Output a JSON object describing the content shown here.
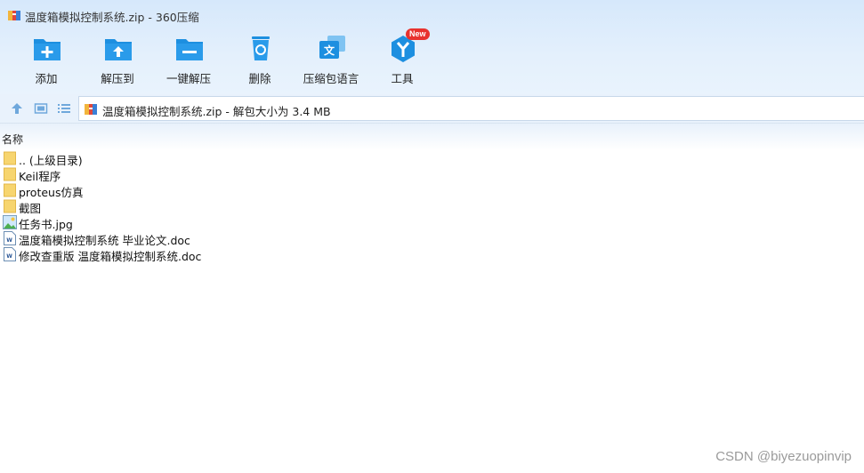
{
  "window": {
    "title": "温度箱模拟控制系统.zip - 360压缩"
  },
  "toolbar": {
    "items": [
      {
        "label": "添加",
        "icon": "add-folder-icon"
      },
      {
        "label": "解压到",
        "icon": "extract-to-icon"
      },
      {
        "label": "一键解压",
        "icon": "one-click-extract-icon"
      },
      {
        "label": "删除",
        "icon": "recycle-bin-icon"
      },
      {
        "label": "压缩包语言",
        "icon": "language-icon"
      },
      {
        "label": "工具",
        "icon": "tools-icon"
      }
    ],
    "new_badge": "New"
  },
  "address": {
    "path": "温度箱模拟控制系统.zip - 解包大小为 3.4 MB"
  },
  "list": {
    "column_name": "名称",
    "files": [
      {
        "name": ".. (上级目录)",
        "type": "folder"
      },
      {
        "name": "Keil程序",
        "type": "folder"
      },
      {
        "name": "proteus仿真",
        "type": "folder"
      },
      {
        "name": "截图",
        "type": "folder"
      },
      {
        "name": "任务书.jpg",
        "type": "image"
      },
      {
        "name": "温度箱模拟控制系统 毕业论文.doc",
        "type": "doc"
      },
      {
        "name": "修改查重版 温度箱模拟控制系统.doc",
        "type": "doc"
      }
    ]
  },
  "watermark": "CSDN @biyezuopinvip",
  "colors": {
    "accent": "#1d8fe0",
    "folder": "#f7d56f",
    "badge": "#e8322e"
  }
}
